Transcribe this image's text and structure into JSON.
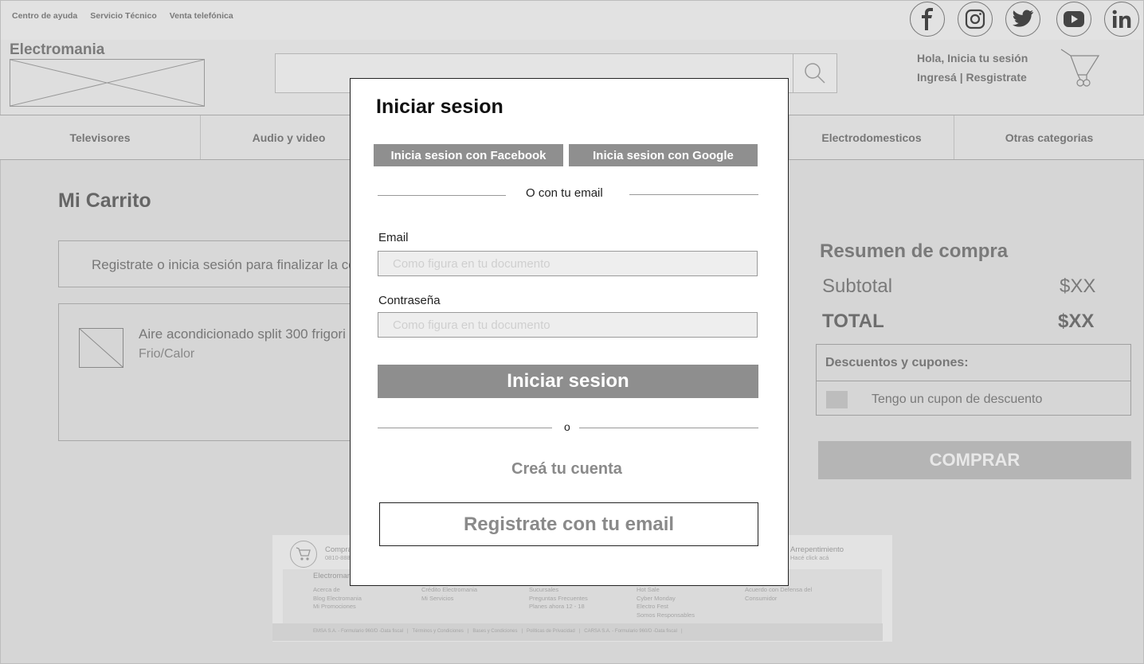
{
  "toplinks": [
    "Centro de ayuda",
    "Servicio Técnico",
    "Venta telefónica"
  ],
  "social_icons": [
    "facebook-icon",
    "instagram-icon",
    "twitter-icon",
    "youtube-icon",
    "linkedin-icon"
  ],
  "header": {
    "brand": "Electromania",
    "greeting": "Hola, Inicia tu sesión",
    "login_link": "Ingresá",
    "separator": "|",
    "register_link": "Resgistrate"
  },
  "nav": [
    "Televisores",
    "Audio y video",
    "Electrodomesticos",
    "Otras categorias"
  ],
  "cart_page": {
    "title": "Mi Carrito",
    "notice": "Registrate o inicia sesión para finalizar la co",
    "item_name": "Aire acondicionado split 300 frigori",
    "item_sub": "Frio/Calor"
  },
  "summary": {
    "title": "Resumen de compra",
    "subtotal_label": "Subtotal",
    "subtotal_value": "$XX",
    "total_label": "TOTAL",
    "total_value": "$XX",
    "discounts_title": "Descuentos y cupones:",
    "coupon_label": "Tengo un cupon de descuento",
    "buy_button": "COMPRAR"
  },
  "footer": {
    "col1_head": "Compra",
    "col1_phone": "0810-888",
    "arrepentimiento": "Arrepentimiento",
    "arrepentimiento_sub": "Hacé click acá",
    "brand": "Electromar",
    "links_col1": [
      "Acerca de",
      "Blog Electromania",
      "Mi Promociones"
    ],
    "links_col2": [
      "Crédito Electromania",
      "Mi Servicios"
    ],
    "links_col3": [
      "Sucursales",
      "Preguntas Frecuentes",
      "Planes ahora 12 - 18"
    ],
    "links_col4": [
      "Hot Sale",
      "Cyber Monday",
      "Electro Fest",
      "Somos Responsables"
    ],
    "links_col5": [
      "Acuerdo con Defensa del",
      "Consumidor"
    ],
    "bottom": "EMSA S.A. - Formulario 960/D -Data fiscal   |   Términos y Condiciones   |   Bases y Condiciones   |   Políticas de Privacidad   |   CARSA S.A. - Formulario 960/D -Data fiscal   |"
  },
  "modal": {
    "title": "Iniciar sesion",
    "facebook_button": "Inicia sesion con Facebook",
    "google_button": "Inicia sesion con Google",
    "divider_text": "O con tu email",
    "email_label": "Email",
    "email_placeholder": "Como figura en tu documento",
    "password_label": "Contraseña",
    "password_placeholder": "Como figura en tu documento",
    "login_button": "Iniciar sesion",
    "or_text": "o",
    "create_account": "Creá tu cuenta",
    "register_button": "Registrate con tu email"
  }
}
